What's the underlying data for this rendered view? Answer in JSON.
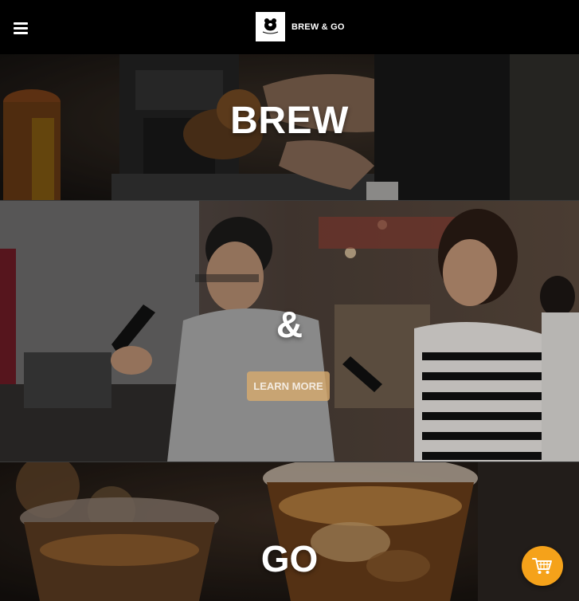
{
  "header": {
    "brand_name": "BREW & GO",
    "logo_text": "BREW & GO",
    "menu_icon": "hamburger-menu-icon"
  },
  "hero": {
    "brew_title": "BREW",
    "amp_title": "&",
    "learn_more_label": "LEARN MORE",
    "go_title": "GO"
  },
  "cart": {
    "icon": "shopping-cart-icon",
    "color": "#f5a21a"
  },
  "colors": {
    "header_bg": "#000000",
    "accent": "#d6aa6e"
  }
}
